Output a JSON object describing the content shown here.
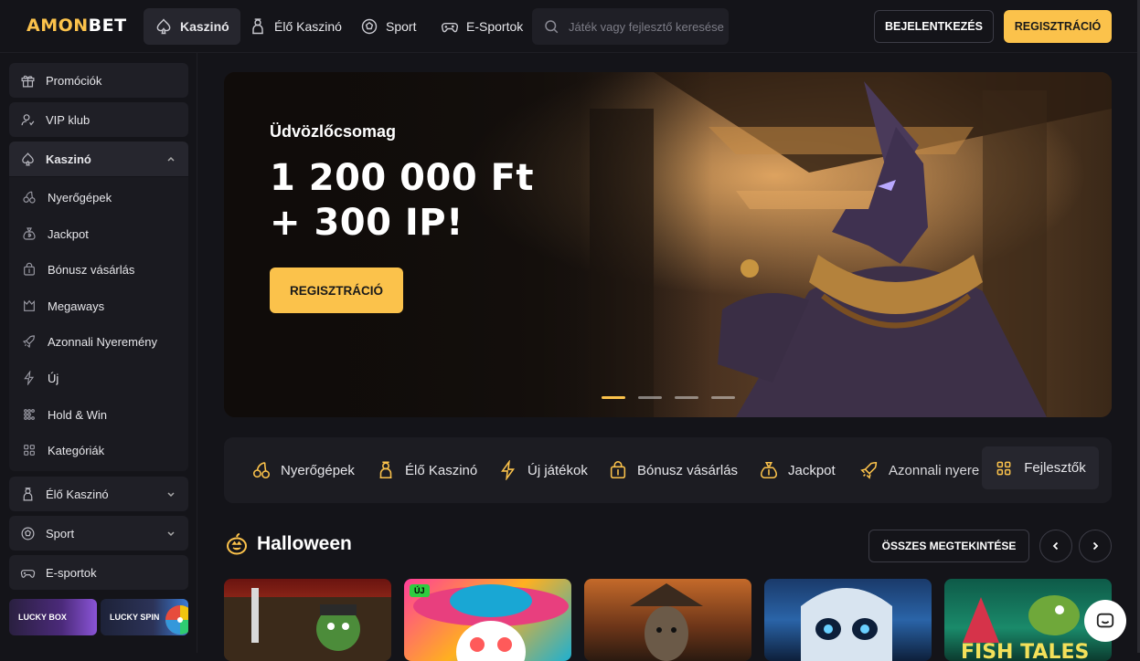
{
  "header": {
    "logo_part1": "AMON",
    "logo_part2": "BET",
    "tabs": [
      {
        "label": "Kaszinó",
        "icon": "spade-icon",
        "active": true
      },
      {
        "label": "Élő Kaszinó",
        "icon": "dealer-icon",
        "active": false
      },
      {
        "label": "Sport",
        "icon": "soccer-ball-icon",
        "active": false
      },
      {
        "label": "E-Sportok",
        "icon": "gamepad-icon",
        "active": false
      }
    ],
    "search_placeholder": "Játék vagy fejlesztő keresése",
    "login_label": "BEJELENTKEZÉS",
    "register_label": "REGISZTRÁCIÓ"
  },
  "sidebar": {
    "items": [
      {
        "label": "Promóciók",
        "icon": "gift-icon"
      },
      {
        "label": "VIP klub",
        "icon": "vip-user-icon"
      },
      {
        "label": "Kaszinó",
        "icon": "spade-icon",
        "expanded": true
      }
    ],
    "casino_sub": [
      {
        "label": "Nyerőgépek",
        "icon": "cherries-icon"
      },
      {
        "label": "Jackpot",
        "icon": "money-bag-icon"
      },
      {
        "label": "Bónusz vásárlás",
        "icon": "bonus-bag-icon"
      },
      {
        "label": "Megaways",
        "icon": "megaways-icon"
      },
      {
        "label": "Azonnali Nyeremény",
        "icon": "rocket-icon"
      },
      {
        "label": "Új",
        "icon": "lightning-icon"
      },
      {
        "label": "Hold & Win",
        "icon": "grid-dots-icon"
      },
      {
        "label": "Kategóriák",
        "icon": "grid-icon"
      }
    ],
    "bottom_items": [
      {
        "label": "Élő Kaszinó",
        "icon": "dealer-icon"
      },
      {
        "label": "Sport",
        "icon": "soccer-ball-icon"
      },
      {
        "label": "E-sportok",
        "icon": "gamepad-icon"
      }
    ],
    "promo_cards": [
      {
        "label": "LUCKY BOX"
      },
      {
        "label": "LUCKY SPIN"
      }
    ]
  },
  "hero": {
    "subtitle": "Üdvözlőcsomag",
    "title_line1": "1 200 000 Ft",
    "title_line2": "+ 300 IP!",
    "button_label": "REGISZTRÁCIÓ",
    "slides_count": 4,
    "active_slide": 1
  },
  "categories": [
    {
      "label": "Nyerőgépek",
      "icon": "cherries-icon"
    },
    {
      "label": "Élő Kaszinó",
      "icon": "dealer-icon"
    },
    {
      "label": "Új játékok",
      "icon": "lightning-icon"
    },
    {
      "label": "Bónusz vásárlás",
      "icon": "bonus-bag-icon"
    },
    {
      "label": "Jackpot",
      "icon": "money-bag-icon"
    },
    {
      "label": "Azonnali nyere",
      "icon": "rocket-icon"
    },
    {
      "label": "Fejlesztők",
      "icon": "grid-icon"
    }
  ],
  "section": {
    "title": "Halloween",
    "icon": "pumpkin-icon",
    "view_all_label": "ÖSSZES MEGTEKINTÉSE"
  },
  "games": [
    {
      "badge": ""
    },
    {
      "badge": "ÚJ"
    },
    {
      "badge": ""
    },
    {
      "badge": ""
    },
    {
      "badge": "",
      "title": "FISH TALES"
    }
  ],
  "colors": {
    "accent": "#fbc24b",
    "background": "#141419",
    "panel": "#1f1f26"
  }
}
